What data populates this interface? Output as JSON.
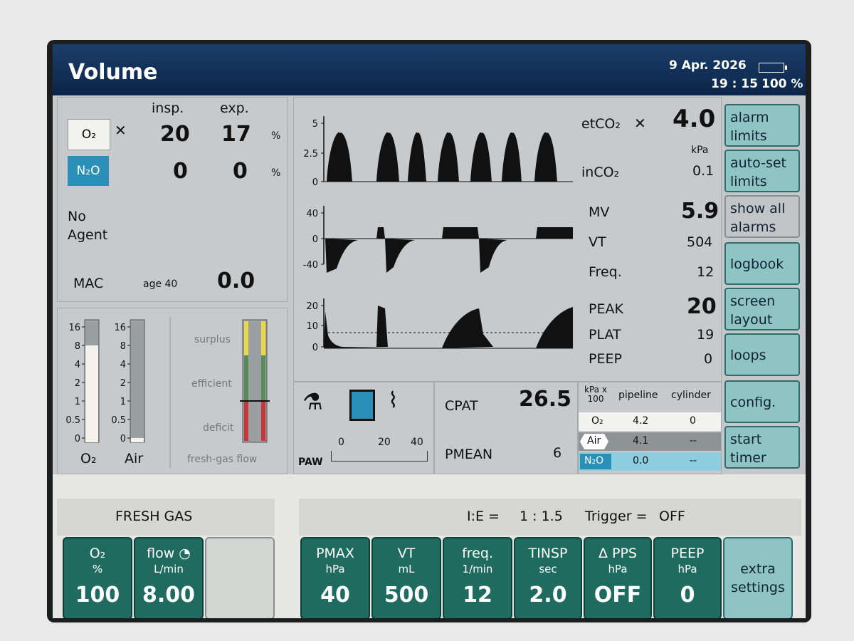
{
  "header": {
    "mode": "Volume",
    "date": "9 Apr. 2026",
    "time": "19 : 15",
    "battery": "100 %"
  },
  "gas_panel": {
    "insp_label": "insp.",
    "exp_label": "exp.",
    "o2": {
      "name": "O₂",
      "insp": "20",
      "exp": "17",
      "unit": "%"
    },
    "n2o": {
      "name": "N₂O",
      "insp": "0",
      "exp": "0",
      "unit": "%"
    },
    "agent": "No\nAgent",
    "mac_label": "MAC",
    "age_label": "age 40",
    "mac_value": "0.0"
  },
  "flowmeters": {
    "o2_ticks": [
      "16",
      "8",
      "4",
      "2",
      "1",
      "0.5",
      "0"
    ],
    "air_ticks": [
      "16",
      "8",
      "4",
      "2",
      "1",
      "0.5",
      "0"
    ],
    "o2_label": "O₂",
    "air_label": "Air",
    "o2_level": 8,
    "air_level": 0,
    "surplus": "surplus",
    "efficient": "efficient",
    "deficit": "deficit",
    "fgf_label": "fresh-gas flow"
  },
  "waveforms": {
    "co2_ticks": [
      "5",
      "2.5",
      "0"
    ],
    "flow_ticks": [
      "40",
      "0",
      "-40"
    ],
    "paw_ticks": [
      "20",
      "10",
      "0"
    ]
  },
  "values": {
    "etco2_label": "etCO₂",
    "etco2": "4.0",
    "kpa": "kPa",
    "inco2_label": "inCO₂",
    "inco2": "0.1",
    "mv_label": "MV",
    "mv": "5.9",
    "vt_label": "VT",
    "vt": "504",
    "freq_label": "Freq.",
    "freq": "12",
    "peak_label": "PEAK",
    "peak": "20",
    "plat_label": "PLAT",
    "plat": "19",
    "peep_label": "PEEP",
    "peep": "0"
  },
  "paw_bar": {
    "label": "PAW",
    "ticks": [
      "0",
      "20",
      "40"
    ],
    "value": 0
  },
  "cpat": {
    "label": "CPAT",
    "value": "26.5",
    "pmean_label": "PMEAN",
    "pmean": "6"
  },
  "supply": {
    "header_unit": "kPa x 100",
    "col1": "pipeline",
    "col2": "cylinder",
    "rows": [
      {
        "gas": "O₂",
        "pipeline": "4.2",
        "cylinder": "0"
      },
      {
        "gas": "Air",
        "pipeline": "4.1",
        "cylinder": "--"
      },
      {
        "gas": "N₂O",
        "pipeline": "0.0",
        "cylinder": "--"
      }
    ]
  },
  "side_buttons": [
    "alarm\nlimits",
    "auto-set\nlimits",
    "show all\nalarms",
    "logbook",
    "screen\nlayout",
    "loops",
    "config.",
    "start\ntimer"
  ],
  "bottom": {
    "fresh_gas": "FRESH GAS",
    "ie_label": "I:E =",
    "ie": "1 : 1.5",
    "trigger_label": "Trigger =",
    "trigger": "OFF",
    "fg_buttons": [
      {
        "name": "O₂",
        "unit": "%",
        "value": "100"
      },
      {
        "name": "flow",
        "unit": "L/min",
        "value": "8.00"
      }
    ],
    "vent_buttons": [
      {
        "name": "PMAX",
        "unit": "hPa",
        "value": "40"
      },
      {
        "name": "VT",
        "unit": "mL",
        "value": "500"
      },
      {
        "name": "freq.",
        "unit": "1/min",
        "value": "12"
      },
      {
        "name": "TINSP",
        "unit": "sec",
        "value": "2.0"
      },
      {
        "name": "Δ PPS",
        "unit": "hPa",
        "value": "OFF"
      },
      {
        "name": "PEEP",
        "unit": "hPa",
        "value": "0"
      }
    ],
    "extra": "extra\nsettings"
  },
  "colors": {
    "teal": "#1f6b5f",
    "side": "#8fc4c4",
    "title": "#12335c",
    "yellow": "#e8d84a",
    "green": "#5a8c5a",
    "red": "#c9353a"
  }
}
